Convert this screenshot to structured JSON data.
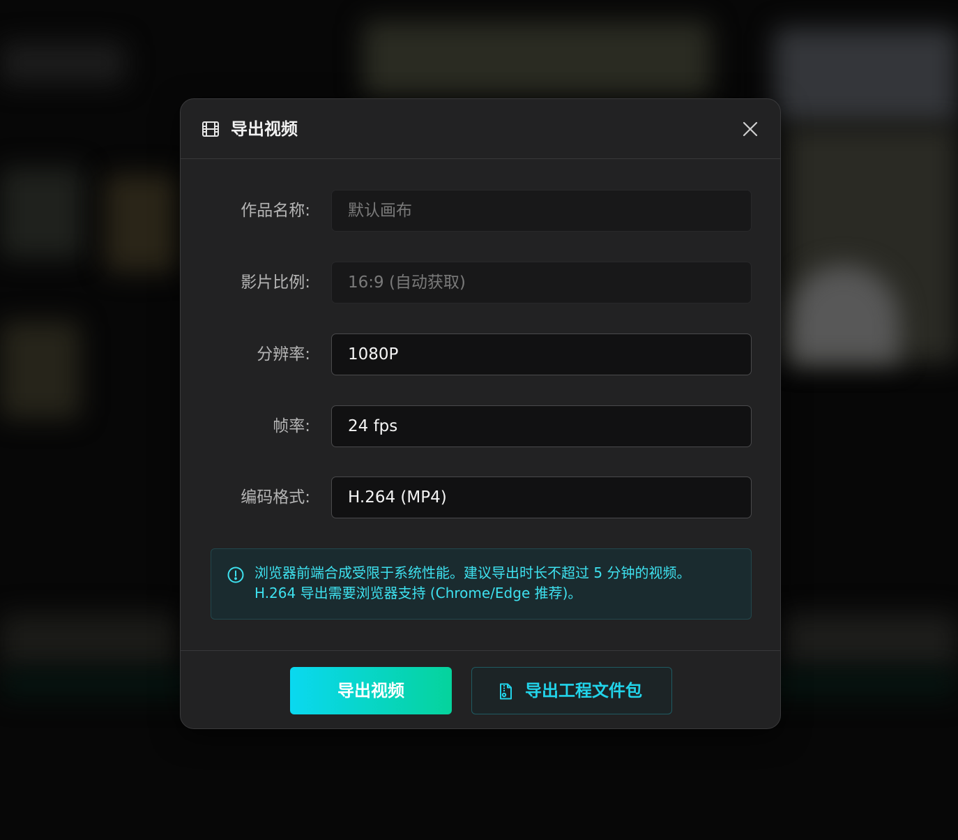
{
  "dialog": {
    "title": "导出视频",
    "header_icon": "film-icon",
    "close_icon": "close-icon"
  },
  "form": {
    "work_name": {
      "label": "作品名称:",
      "placeholder": "默认画布",
      "value": ""
    },
    "aspect_ratio": {
      "label": "影片比例:",
      "value": "16:9 (自动获取)"
    },
    "resolution": {
      "label": "分辨率:",
      "value": "1080P"
    },
    "frame_rate": {
      "label": "帧率:",
      "value": "24 fps"
    },
    "codec": {
      "label": "编码格式:",
      "value": "H.264 (MP4)"
    }
  },
  "notice": {
    "icon": "info-circle-icon",
    "line1": "浏览器前端合成受限于系统性能。建议导出时长不超过 5 分钟的视频。",
    "line2": "H.264 导出需要浏览器支持 (Chrome/Edge 推荐)。"
  },
  "footer": {
    "export_video_label": "导出视频",
    "export_project_label": "导出工程文件包",
    "export_project_icon": "file-archive-icon"
  },
  "colors": {
    "accent_cyan": "#0ad8f0",
    "accent_green": "#05d39c",
    "notice_text": "#3ee1ef",
    "dialog_bg": "#222223"
  }
}
